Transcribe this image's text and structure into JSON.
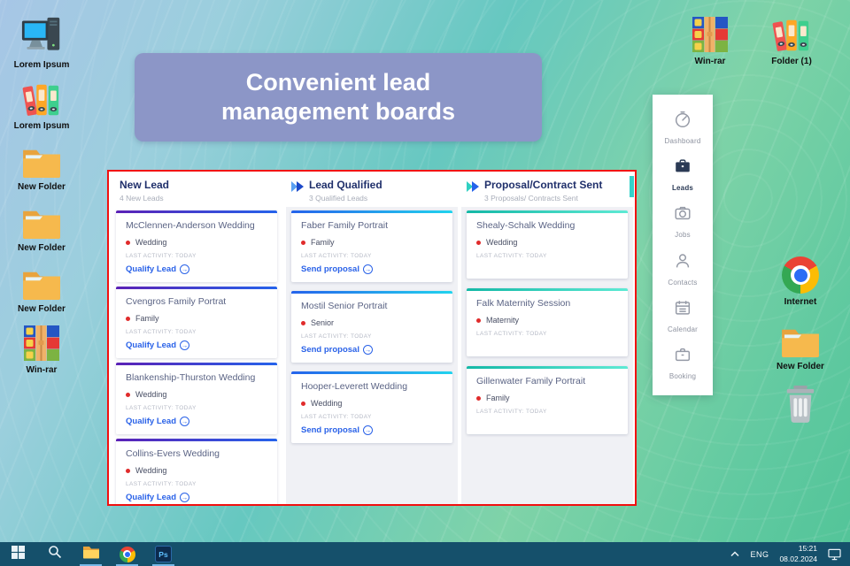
{
  "banner": {
    "line1": "Convenient lead",
    "line2": "management boards",
    "bg_color": "#8c96c7"
  },
  "desktop": {
    "left_icons": [
      {
        "label": "Lorem Ipsum",
        "icon": "computer-icon"
      },
      {
        "label": "Lorem Ipsum",
        "icon": "binders-icon"
      },
      {
        "label": "New Folder",
        "icon": "folder-icon"
      },
      {
        "label": "New Folder",
        "icon": "folder-icon"
      },
      {
        "label": "New Folder",
        "icon": "folder-icon"
      },
      {
        "label": "Win-rar",
        "icon": "winrar-icon"
      }
    ],
    "top_right_icons": [
      {
        "label": "Win-rar",
        "icon": "winrar-icon"
      },
      {
        "label": "Folder (1)",
        "icon": "binders-icon"
      }
    ],
    "right_icons": [
      {
        "label": "Internet",
        "icon": "chrome-icon"
      },
      {
        "label": "New Folder",
        "icon": "folder-icon"
      },
      {
        "label": "",
        "icon": "trash-icon"
      }
    ]
  },
  "board": {
    "border_color": "#f10f0f",
    "scrollbar_color": "#35d1c9",
    "tag_dot_color": "#e02b2b",
    "action_color": "#2a62e8",
    "columns": [
      {
        "title": "New Lead",
        "subtitle": "4 New Leads",
        "arrow": null,
        "accent_from": "#5b21b6",
        "accent_to": "#2563eb",
        "body_bg": "#ffffff",
        "cards": [
          {
            "title": "McClennen-Anderson Wedding",
            "tag": "Wedding",
            "activity": "LAST ACTIVITY: TODAY",
            "action": "Qualify Lead"
          },
          {
            "title": "Cvengros Family Portrat",
            "tag": "Family",
            "activity": "LAST ACTIVITY: TODAY",
            "action": "Qualify Lead"
          },
          {
            "title": "Blankenship-Thurston Wedding",
            "tag": "Wedding",
            "activity": "LAST ACTIVITY: TODAY",
            "action": "Qualify Lead"
          },
          {
            "title": "Collins-Evers Wedding",
            "tag": "Wedding",
            "activity": "LAST ACTIVITY: TODAY",
            "action": "Qualify Lead"
          }
        ]
      },
      {
        "title": "Lead Qualified",
        "subtitle": "3 Qualified Leads",
        "arrow": {
          "from": "#5aa0f2",
          "to": "#1c49c9"
        },
        "accent_from": "#2563eb",
        "accent_to": "#22d3ee",
        "body_bg": "#f0f1f5",
        "cards": [
          {
            "title": "Faber Family Portrait",
            "tag": "Family",
            "activity": "LAST ACTIVITY: TODAY",
            "action": "Send proposal"
          },
          {
            "title": "Mostil Senior Portrait",
            "tag": "Senior",
            "activity": "LAST ACTIVITY: TODAY",
            "action": "Send proposal"
          },
          {
            "title": "Hooper-Leverett Wedding",
            "tag": "Wedding",
            "activity": "LAST ACTIVITY: TODAY",
            "action": "Send proposal"
          }
        ]
      },
      {
        "title": "Proposal/Contract Sent",
        "subtitle": "3 Proposals/ Contracts Sent",
        "arrow": {
          "from": "#2fd0c2",
          "to": "#2563eb"
        },
        "accent_from": "#14b8a6",
        "accent_to": "#5eead4",
        "body_bg": "#f0f1f5",
        "cards": [
          {
            "title": "Shealy-Schalk Wedding",
            "tag": "Wedding",
            "activity": "LAST ACTIVITY: TODAY",
            "action": null
          },
          {
            "title": "Falk Maternity Session",
            "tag": "Maternity",
            "activity": "LAST ACTIVITY: TODAY",
            "action": null
          },
          {
            "title": "Gillenwater Family Portrait",
            "tag": "Family",
            "activity": "LAST ACTIVITY: TODAY",
            "action": null
          }
        ]
      }
    ]
  },
  "sidebar": {
    "items": [
      {
        "label": "Dashboard",
        "icon": "gauge-icon",
        "active": false
      },
      {
        "label": "Leads",
        "icon": "briefcase-icon",
        "active": true
      },
      {
        "label": "Jobs",
        "icon": "camera-icon",
        "active": false
      },
      {
        "label": "Contacts",
        "icon": "person-icon",
        "active": false
      },
      {
        "label": "Calendar",
        "icon": "calendar-icon",
        "active": false
      },
      {
        "label": "Booking",
        "icon": "briefcase-outline-icon",
        "active": false
      }
    ]
  },
  "taskbar": {
    "bg_color": "#15506b",
    "apps": [
      {
        "name": "start",
        "icon": "windows-start-icon",
        "active": false
      },
      {
        "name": "search",
        "icon": "search-icon",
        "active": false
      },
      {
        "name": "file-explorer",
        "icon": "explorer-icon",
        "active": true
      },
      {
        "name": "chrome",
        "icon": "chrome-icon",
        "active": true
      },
      {
        "name": "photoshop",
        "icon": "photoshop-icon",
        "active": true,
        "label": "Ps"
      }
    ],
    "tray": {
      "language": "ENG",
      "time": "15:21",
      "date": "08.02.2024"
    }
  }
}
